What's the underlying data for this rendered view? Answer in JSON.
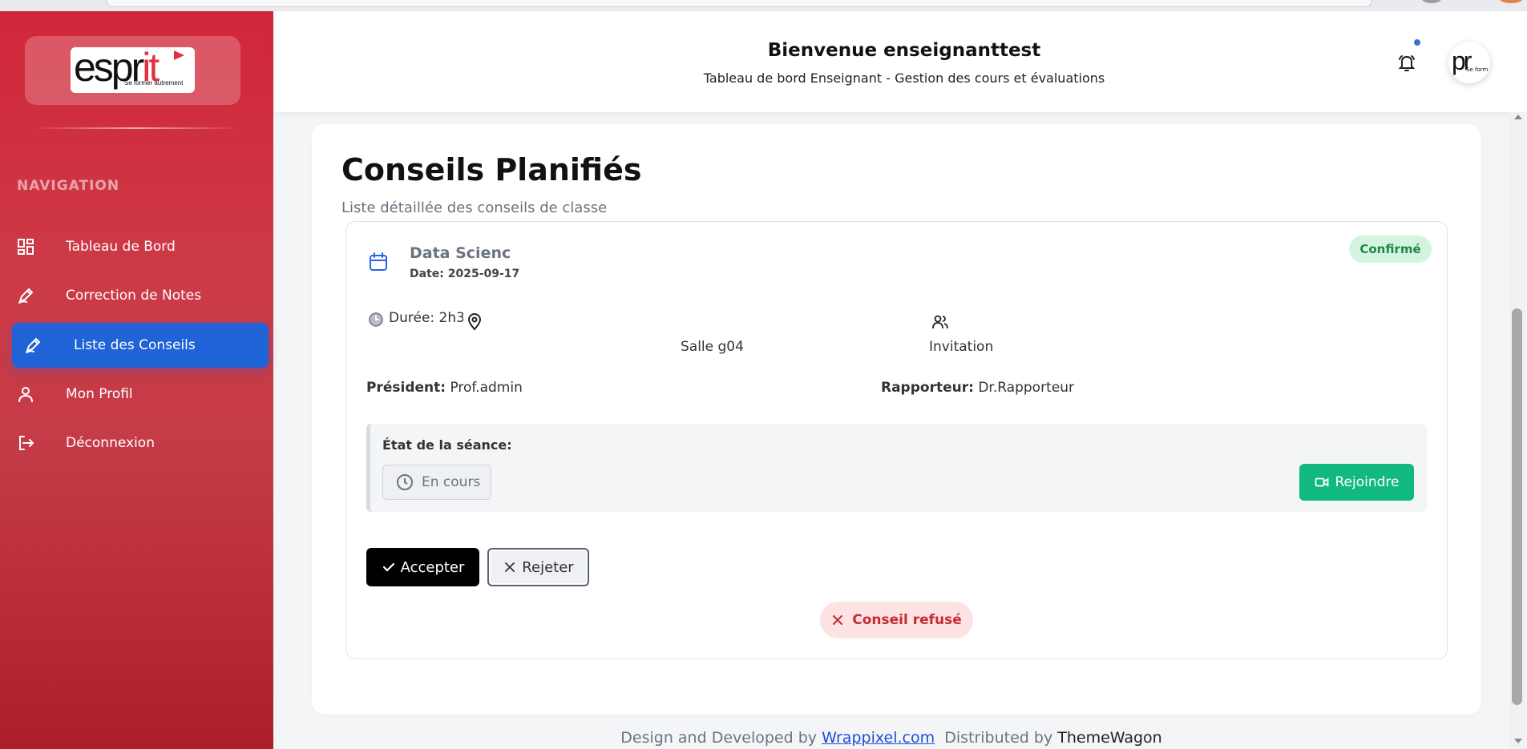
{
  "sidebar": {
    "logo": {
      "word_main": "espr",
      "word_accent": "it",
      "tagline": "Se former autrement"
    },
    "nav_heading": "NAVIGATION",
    "items": [
      {
        "label": "Tableau de Bord",
        "icon": "dashboard-icon",
        "active": false
      },
      {
        "label": "Correction de Notes",
        "icon": "pencil-icon",
        "active": false
      },
      {
        "label": "Liste des Conseils",
        "icon": "pencil-icon",
        "active": true
      },
      {
        "label": "Mon Profil",
        "icon": "user-icon",
        "active": false
      },
      {
        "label": "Déconnexion",
        "icon": "logout-icon",
        "active": false
      }
    ]
  },
  "header": {
    "title": "Bienvenue enseignanttest",
    "subtitle": "Tableau de bord Enseignant - Gestion des cours et évaluations",
    "notification_icon": "bell-icon",
    "avatar": {
      "mark": "pr",
      "caption": "Se form"
    }
  },
  "main": {
    "title": "Conseils Planifiés",
    "subtitle": "Liste détaillée des conseils de classe",
    "conseil": {
      "name": "Data Scienc",
      "date": "Date: 2025-09-17",
      "status_badge": "Confirmé",
      "duree": "Durée: 2h30",
      "salle": "Salle g04",
      "participants": "Invitation",
      "president_label": "Président:",
      "president_value": "Prof.admin",
      "rapporteur_label": "Rapporteur:",
      "rapporteur_value": "Dr.Rapporteur",
      "etat_label": "État de la séance:",
      "etat_value": "En cours",
      "join_label": "Rejoindre",
      "accept_label": "Accepter",
      "reject_label": "Rejeter",
      "refused_label": "Conseil refusé"
    }
  },
  "footer": {
    "prefix": "Design and Developed by",
    "link": "Wrappixel.com",
    "middle": "Distributed by",
    "brand": "ThemeWagon"
  },
  "colors": {
    "sidebar_top": "#d2263a",
    "sidebar_bottom": "#ad1e2a",
    "active_nav": "#1f63d6",
    "accept_button": "#000000",
    "join_button": "#11b981",
    "confirm_badge": "#d5f4df",
    "refused_badge": "#fde3e3"
  }
}
